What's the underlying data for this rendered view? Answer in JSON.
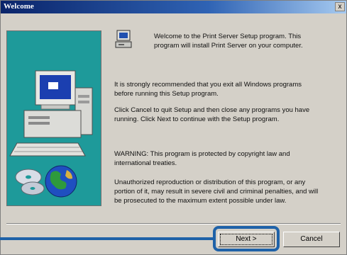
{
  "window": {
    "title": "Welcome",
    "close_glyph": "x"
  },
  "welcome_text": "Welcome to the Print Server Setup program.  This program will install Print Server on your computer.",
  "paragraphs": {
    "p1": "It is strongly recommended that you exit all Windows programs before running this Setup program.",
    "p2": "Click Cancel to quit Setup and then close any programs you have running.  Click Next to continue with the Setup program.",
    "p3": "WARNING: This program is protected by copyright law and international treaties.",
    "p4": "Unauthorized reproduction or distribution of this program, or any portion of it, may result in severe civil and criminal penalties, and will be prosecuted to the maximum extent possible under law."
  },
  "buttons": {
    "next": "Next >",
    "cancel": "Cancel"
  },
  "icons": {
    "setup": "setup-computer-icon",
    "illustration": "computer-globe-cd-illustration"
  },
  "colors": {
    "title_bar": "#0a246a",
    "art_panel": "#1e9a9a",
    "highlight": "#1f62a8"
  }
}
